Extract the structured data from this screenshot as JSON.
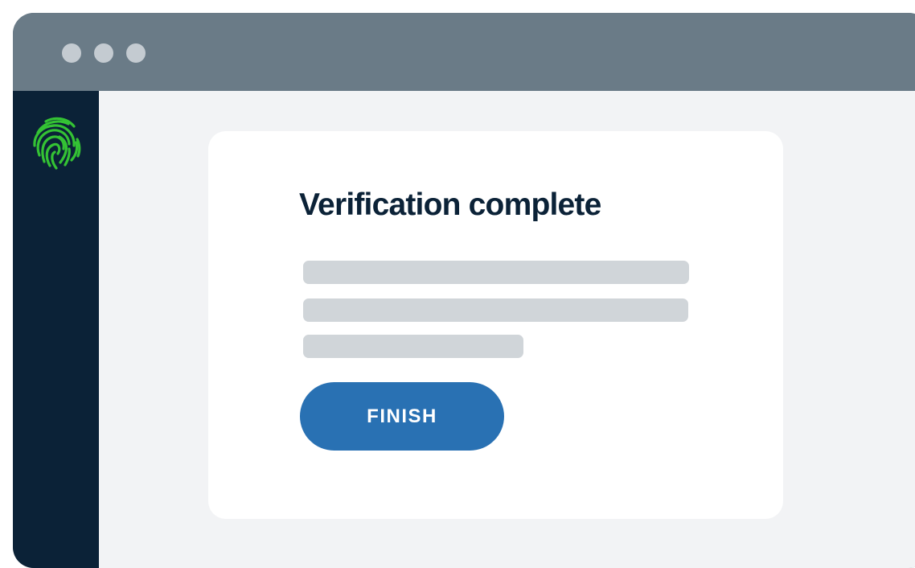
{
  "window": {
    "controls": [
      "window-dot",
      "window-dot",
      "window-dot"
    ]
  },
  "sidebar": {
    "logo_icon": "fingerprint-icon",
    "logo_color": "#34c234"
  },
  "card": {
    "title": "Verification complete",
    "finish_label": "FINISH"
  },
  "colors": {
    "titlebar": "#6a7b87",
    "sidebar": "#0b2237",
    "content_bg": "#f2f3f5",
    "card_bg": "#ffffff",
    "title_text": "#0b2237",
    "placeholder_line": "#d0d5d9",
    "button": "#2971b3",
    "button_text": "#ffffff"
  }
}
